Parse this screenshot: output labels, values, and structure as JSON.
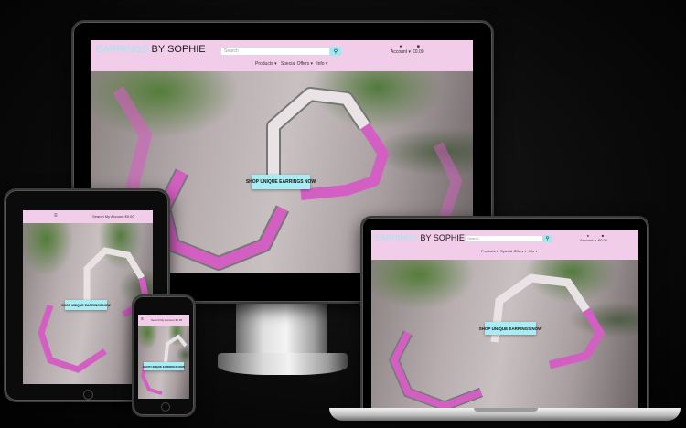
{
  "brand": {
    "logo_highlight": "EARRINGS",
    "logo_text": "BY SOPHIE"
  },
  "nav": {
    "search_placeholder": "Search",
    "account_label": "Account ▾",
    "basket_total": "€0.00",
    "menu_items": [
      "Products ▾",
      "Special Offers ▾",
      "Info ▾"
    ],
    "mobile_links": "Search   My Account   €0.00"
  },
  "hero": {
    "cta_label": "SHOP UNIQUE EARRINGS NOW"
  },
  "colors": {
    "nav_pink": "#f2cdea",
    "accent_cyan": "#9ee9f2",
    "earring_pink": "#d35fc2"
  },
  "icons": [
    "search-icon",
    "user-icon",
    "basket-icon",
    "hamburger-icon"
  ]
}
